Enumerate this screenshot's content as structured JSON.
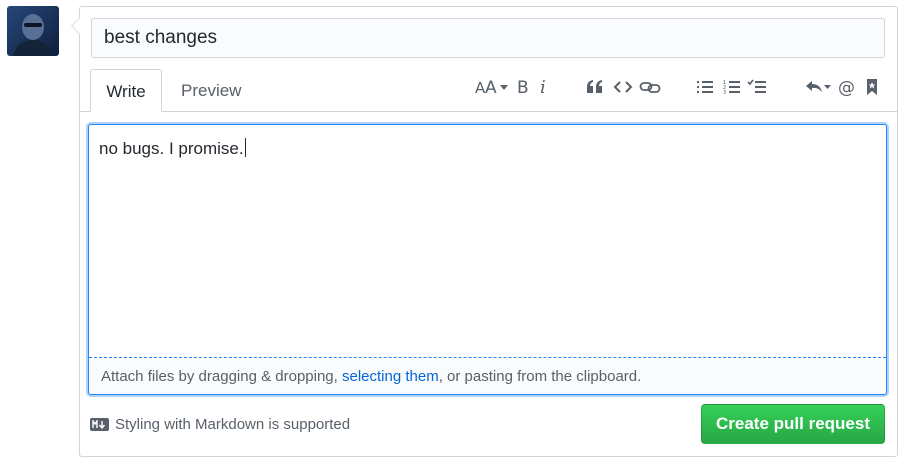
{
  "title_input": {
    "value": "best changes"
  },
  "tabs": [
    {
      "label": "Write",
      "active": true
    },
    {
      "label": "Preview",
      "active": false
    }
  ],
  "toolbar": {
    "icons": [
      "text-size-icon",
      "bold-icon",
      "italic-icon",
      "quote-icon",
      "code-icon",
      "link-icon",
      "unordered-list-icon",
      "ordered-list-icon",
      "task-list-icon",
      "reply-icon",
      "mention-icon",
      "bookmark-icon"
    ]
  },
  "editor": {
    "text": "no bugs. I promise.",
    "attach_prefix": "Attach files by dragging & dropping, ",
    "attach_link": "selecting them",
    "attach_suffix": ", or pasting from the clipboard."
  },
  "footer": {
    "markdown_note": "Styling with Markdown is supported",
    "submit_label": "Create pull request"
  },
  "colors": {
    "accent": "#2188ff",
    "link": "#0366d6",
    "submit_green": "#28a745"
  }
}
